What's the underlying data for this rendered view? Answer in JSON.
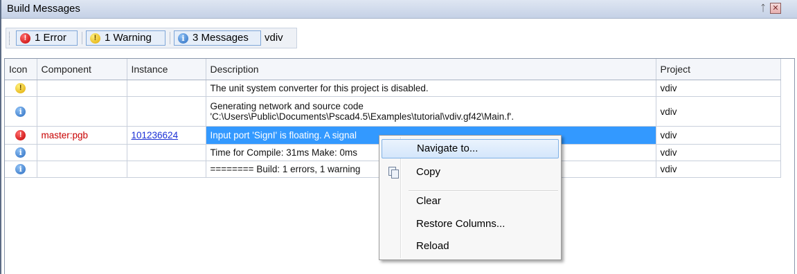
{
  "window": {
    "title": "Build Messages",
    "pin_glyph": "📌",
    "close_glyph": "✕"
  },
  "toolbar": {
    "errors_label": "1 Error",
    "warnings_label": "1 Warning",
    "messages_label": "3 Messages",
    "filter_text": "vdiv"
  },
  "table": {
    "columns": [
      "Icon",
      "Component",
      "Instance",
      "Description",
      "Project"
    ],
    "rows": [
      {
        "icon": "warning-icon",
        "component": "",
        "instance": "",
        "description": "The unit system converter for this project is disabled.",
        "description2": "",
        "project": "vdiv"
      },
      {
        "icon": "info-icon",
        "component": "",
        "instance": "",
        "description": "Generating network and source code",
        "description2": "'C:\\Users\\Public\\Documents\\Pscad4.5\\Examples\\tutorial\\vdiv.gf42\\Main.f'.",
        "project": "vdiv"
      },
      {
        "icon": "error-icon",
        "component": "master:pgb",
        "instance": "101236624",
        "description": "Input port 'SignI' is floating. A signal",
        "description2": "",
        "project": "vdiv"
      },
      {
        "icon": "info-icon",
        "component": "",
        "instance": "",
        "description": "Time for Compile: 31ms  Make: 0ms",
        "description2": "",
        "project": "vdiv"
      },
      {
        "icon": "info-icon",
        "component": "",
        "instance": "",
        "description": "======== Build: 1 errors, 1 warning",
        "description2": "",
        "project": "vdiv"
      }
    ]
  },
  "context_menu": {
    "items": [
      "Navigate to...",
      "Copy",
      "Clear",
      "Restore Columns...",
      "Reload"
    ]
  },
  "colors": {
    "selection": "#3399ff",
    "error": "#c30000",
    "warning": "#e0a800",
    "info": "#2a6cc0",
    "link": "#1a2fd6"
  }
}
